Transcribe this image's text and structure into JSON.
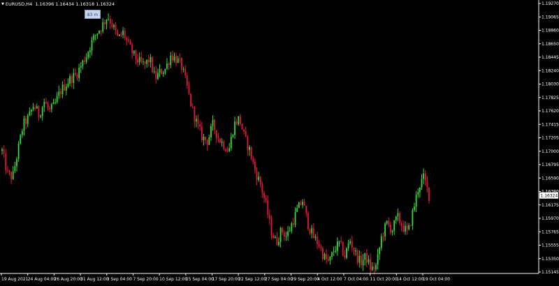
{
  "header": {
    "symbol": "EURUSD,H4",
    "ohlc": "1.16396 1.16434 1.16318 1.16324"
  },
  "timer_badge": "83 m",
  "colors": {
    "background": "#000000",
    "frame": "#ffffff",
    "bull": "#33dd33",
    "bear": "#e8143c",
    "price_label_bg": "#ffffff",
    "price_label_text": "#000000"
  },
  "chart_data": {
    "type": "candlestick",
    "symbol": "EURUSD",
    "timeframe": "H4",
    "ylim": [
      1.1514,
      1.1927
    ],
    "y_ticks": [
      "1.19270",
      "1.19065",
      "1.18860",
      "1.18650",
      "1.18445",
      "1.18240",
      "1.18030",
      "1.17825",
      "1.17620",
      "1.17415",
      "1.17205",
      "1.17000",
      "1.16795",
      "1.16590",
      "1.16380",
      "1.16175",
      "1.15970",
      "1.15765",
      "1.15555",
      "1.15350",
      "1.15145"
    ],
    "x_ticks": [
      "19 Aug 2021",
      "24 Aug 04:00",
      "26 Aug 20:00",
      "31 Aug 12:00",
      "3 Sep 04:00",
      "7 Sep 20:00",
      "10 Sep 12:00",
      "15 Sep 04:00",
      "17 Sep 20:00",
      "22 Sep 12:00",
      "27 Sep 04:00",
      "29 Sep 20:00",
      "4 Oct 12:00",
      "7 Oct 04:00",
      "11 Oct 20:00",
      "14 Oct 12:00",
      "19 Oct 04:00"
    ],
    "current_price": "1.16324",
    "grid": false,
    "path": [
      1.17,
      1.1665,
      1.166,
      1.17,
      1.174,
      1.175,
      1.177,
      1.1755,
      1.1775,
      1.176,
      1.177,
      1.179,
      1.18,
      1.181,
      1.1815,
      1.183,
      1.1845,
      1.1865,
      1.188,
      1.189,
      1.1905,
      1.189,
      1.187,
      1.188,
      1.186,
      1.1845,
      1.1835,
      1.183,
      1.184,
      1.181,
      1.182,
      1.1825,
      1.1845,
      1.184,
      1.183,
      1.18,
      1.1765,
      1.174,
      1.172,
      1.1715,
      1.174,
      1.172,
      1.171,
      1.17,
      1.174,
      1.175,
      1.172,
      1.17,
      1.167,
      1.165,
      1.162,
      1.158,
      1.156,
      1.158,
      1.157,
      1.159,
      1.161,
      1.1625,
      1.159,
      1.157,
      1.156,
      1.154,
      1.153,
      1.155,
      1.156,
      1.154,
      1.1565,
      1.1545,
      1.153,
      1.154,
      1.152,
      1.1525,
      1.157,
      1.159,
      1.158,
      1.16,
      1.1585,
      1.1575,
      1.161,
      1.1645,
      1.166,
      1.1632
    ]
  }
}
